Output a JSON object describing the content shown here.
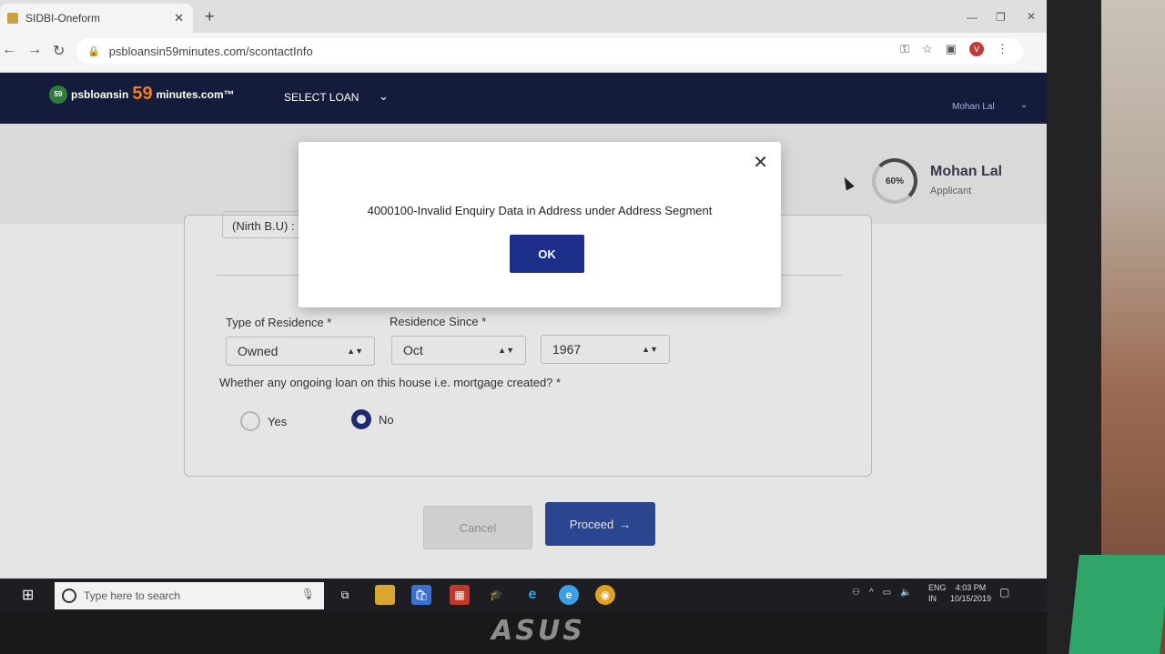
{
  "browser": {
    "tab_title": "SIDBI-Oneform",
    "tab_close": "✕",
    "new_tab": "+",
    "url": "psbloansin59minutes.com/scontactInfo",
    "profile_initial": "V"
  },
  "site": {
    "logo_badge": "59",
    "logo_prefix": "psbloansin",
    "logo_number": "59",
    "logo_suffix": "minutes.com™",
    "nav_select_loan": "SELECT LOAN",
    "header_user": "Mohan Lal"
  },
  "progress": {
    "percent_label": "60%",
    "applicant_name": "Mohan Lal",
    "applicant_role": "Applicant"
  },
  "form": {
    "previous_field_value": "(Nirth B.U) :",
    "residence_type_label": "Type of Residence *",
    "residence_type_value": "Owned",
    "residence_since_label": "Residence Since *",
    "residence_since_month": "Oct",
    "residence_since_year": "1967",
    "mortgage_question": "Whether any ongoing loan on this house i.e. mortgage created? *",
    "radio_yes": "Yes",
    "radio_no": "No",
    "selected_option": "No",
    "cancel_label": "Cancel",
    "proceed_label": "Proceed",
    "proceed_arrow": "→"
  },
  "modal": {
    "message": "4000100-Invalid Enquiry Data in Address under Address Segment",
    "ok_label": "OK",
    "close_glyph": "✕"
  },
  "taskbar": {
    "search_placeholder": "Type here to search",
    "language_top": "ENG",
    "language_bottom": "IN",
    "time": "4:03 PM",
    "date": "10/15/2019"
  },
  "device": {
    "brand": "ASUS"
  },
  "colors": {
    "header_bg": "#151b3a",
    "primary_button": "#2c4aa0",
    "modal_ok": "#1c2d8a",
    "logo_accent": "#f07d22"
  }
}
